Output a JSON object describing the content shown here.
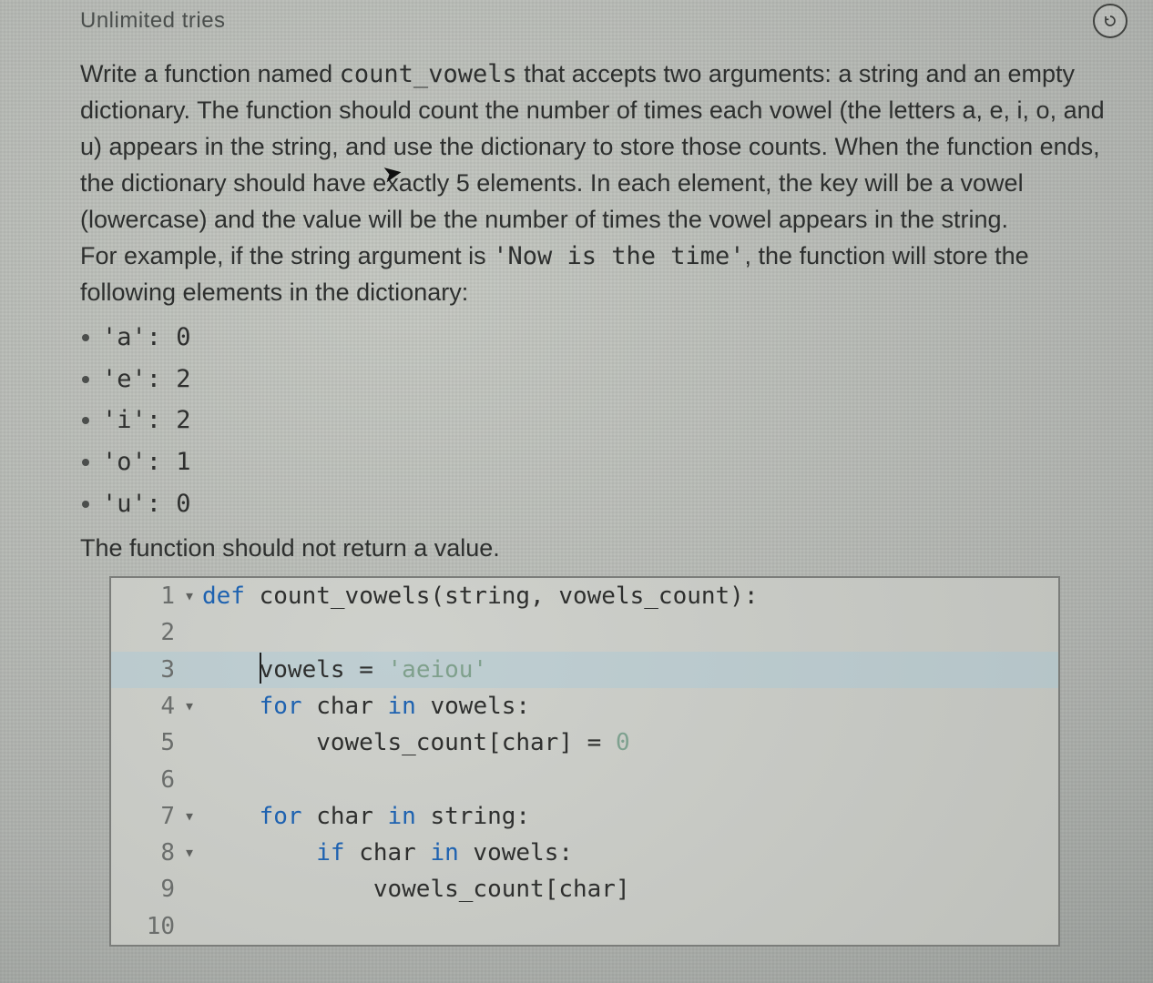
{
  "topbar": {
    "tries_label": "Unlimited tries"
  },
  "prompt": {
    "p1a": "Write a function named ",
    "fn_name": "count_vowels",
    "p1b": " that accepts two arguments: a string and an empty dictionary. The function should count the number of times each vowel (the letters a, e, i, o, and u) appears in the string, and use the dictionary to store those counts. When the function ends, the dictionary should have exactly 5 elements. In each element, the key will be a vowel (lowercase) and the value will be the number of times the vowel appears in the string.",
    "p2a": "For example, if the string argument is ",
    "example_str": "'Now is the time'",
    "p2b": ", the function will store the following elements in the dictionary:",
    "dict": [
      "'a': 0",
      "'e': 2",
      "'i': 2",
      "'o': 1",
      "'u': 0"
    ],
    "p3": "The function should not return a value."
  },
  "editor": {
    "lines": [
      {
        "n": "1",
        "fold": "▾",
        "tokens": [
          {
            "cls": "kw",
            "t": "def"
          },
          {
            "cls": "id",
            "t": " count_vowels(string, vowels_count):"
          }
        ]
      },
      {
        "n": "2",
        "fold": "",
        "tokens": [
          {
            "cls": "id",
            "t": ""
          }
        ]
      },
      {
        "n": "3",
        "fold": "",
        "tokens": [
          {
            "cls": "id",
            "t": "    "
          },
          {
            "caret": true
          },
          {
            "cls": "id",
            "t": "vowels = "
          },
          {
            "cls": "str",
            "t": "'aeiou'"
          }
        ],
        "sel": true
      },
      {
        "n": "4",
        "fold": "▾",
        "tokens": [
          {
            "cls": "id",
            "t": "    "
          },
          {
            "cls": "kw",
            "t": "for"
          },
          {
            "cls": "id",
            "t": " char "
          },
          {
            "cls": "kw",
            "t": "in"
          },
          {
            "cls": "id",
            "t": " vowels:"
          }
        ]
      },
      {
        "n": "5",
        "fold": "",
        "tokens": [
          {
            "cls": "id",
            "t": "        vowels_count[char] = "
          },
          {
            "cls": "num",
            "t": "0"
          }
        ]
      },
      {
        "n": "6",
        "fold": "",
        "tokens": [
          {
            "cls": "id",
            "t": ""
          }
        ]
      },
      {
        "n": "7",
        "fold": "▾",
        "tokens": [
          {
            "cls": "id",
            "t": "    "
          },
          {
            "cls": "kw",
            "t": "for"
          },
          {
            "cls": "id",
            "t": " char "
          },
          {
            "cls": "kw",
            "t": "in"
          },
          {
            "cls": "id",
            "t": " string:"
          }
        ]
      },
      {
        "n": "8",
        "fold": "▾",
        "tokens": [
          {
            "cls": "id",
            "t": "        "
          },
          {
            "cls": "kw",
            "t": "if"
          },
          {
            "cls": "id",
            "t": " char "
          },
          {
            "cls": "kw",
            "t": "in"
          },
          {
            "cls": "id",
            "t": " vowels:"
          }
        ]
      },
      {
        "n": "9",
        "fold": "",
        "tokens": [
          {
            "cls": "id",
            "t": "            vowels_count[char]"
          }
        ]
      },
      {
        "n": "10",
        "fold": "",
        "tokens": [
          {
            "cls": "id",
            "t": ""
          }
        ]
      }
    ]
  }
}
